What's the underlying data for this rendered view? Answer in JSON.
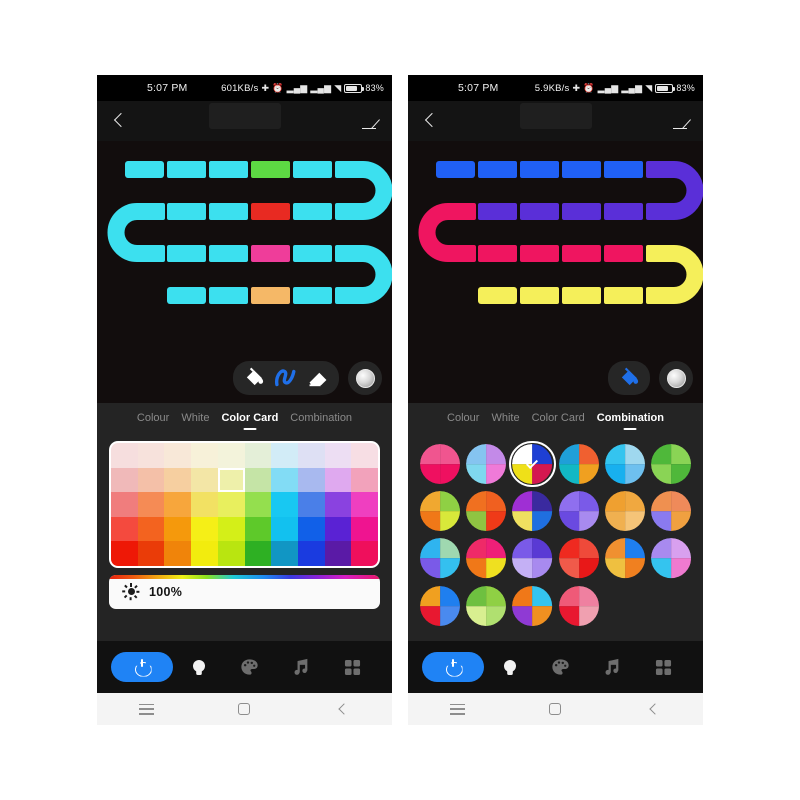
{
  "phones": [
    {
      "id": "left",
      "status": {
        "time": "5:07 PM",
        "net_speed": "601KB/s",
        "battery_pct": "83%",
        "icons": [
          "bluetooth-icon",
          "alarm-icon",
          "signal-icon",
          "signal-icon",
          "wifi-icon",
          "battery-icon"
        ]
      },
      "appbar": {
        "back": "back-icon",
        "edit": "edit-pencil-icon"
      },
      "strip": {
        "base_color": "#3ce0ef",
        "segments": [
          {
            "row": 1,
            "index": 4,
            "color": "#5dd943"
          },
          {
            "row": 2,
            "index": 4,
            "color": "#e82a22"
          },
          {
            "row": 3,
            "index": 4,
            "color": "#ef3d9a"
          },
          {
            "row": 4,
            "index": 4,
            "color": "#f5b867"
          }
        ]
      },
      "toolbar": {
        "tools": [
          {
            "name": "paint-bucket-tool",
            "active": false
          },
          {
            "name": "brush-tool",
            "active": true
          },
          {
            "name": "eraser-tool",
            "active": false
          }
        ],
        "color_knob": "color-knob-button"
      },
      "tabs": [
        {
          "label": "Colour",
          "active": false
        },
        {
          "label": "White",
          "active": false
        },
        {
          "label": "Color Card",
          "active": true
        },
        {
          "label": "Combination",
          "active": false
        }
      ],
      "panel_type": "palette",
      "palette": {
        "selected_row": 1,
        "selected_col": 4,
        "rows": [
          [
            "#f6dede",
            "#f7e2dc",
            "#f8e8d8",
            "#f7f1d9",
            "#f3f3db",
            "#e4efd8",
            "#d2ecf7",
            "#dee0f4",
            "#eddef3",
            "#f7dee4"
          ],
          [
            "#f0b9b9",
            "#f4c0a8",
            "#f6cfa0",
            "#f3e6a6",
            "#eef0aa",
            "#c5e4a6",
            "#82dcf5",
            "#a8b9ef",
            "#dfa9ef",
            "#f2a2bb"
          ],
          [
            "#f07d7d",
            "#f58b55",
            "#f7a63c",
            "#f2e163",
            "#e8ef5e",
            "#94df4e",
            "#18c8f2",
            "#4a7fe8",
            "#8a42e0",
            "#ef3fc0"
          ],
          [
            "#f44a3e",
            "#f3631f",
            "#f5990c",
            "#f5ef17",
            "#d4ef18",
            "#5ec92a",
            "#12c1ef",
            "#1160e8",
            "#5a22d4",
            "#ef1490"
          ],
          [
            "#ee1806",
            "#ea3c08",
            "#f0840a",
            "#f2ec0e",
            "#b9e510",
            "#2eb023",
            "#1196c4",
            "#1a3be0",
            "#5a1aa6",
            "#ef0f5c"
          ]
        ]
      },
      "brightness": {
        "icon": "sun-icon",
        "value": "100%"
      },
      "bottomnav": {
        "power": "power-button",
        "items": [
          "bulb-icon",
          "palette-icon",
          "music-note-icon",
          "grid-icon"
        ],
        "active": "bulb-icon",
        "accent": "#1f83f5"
      },
      "androidnav": [
        "menu-icon",
        "home-icon",
        "back-icon"
      ]
    },
    {
      "id": "right",
      "status": {
        "time": "5:07 PM",
        "net_speed": "5.9KB/s",
        "battery_pct": "83%",
        "icons": [
          "bluetooth-icon",
          "alarm-icon",
          "signal-icon",
          "signal-icon",
          "wifi-icon",
          "battery-icon"
        ]
      },
      "appbar": {
        "back": "back-icon",
        "edit": "edit-pencil-icon"
      },
      "strip": {
        "base_color": "#2050f0",
        "row_colors": [
          "#2060f5",
          "#6a2fd4",
          "#ef1560",
          "#f5ef5a"
        ]
      },
      "toolbar": {
        "tools": [
          {
            "name": "paint-bucket-tool",
            "active": true
          }
        ],
        "color_knob": "color-knob-button"
      },
      "tabs": [
        {
          "label": "Colour",
          "active": false
        },
        {
          "label": "White",
          "active": false
        },
        {
          "label": "Color Card",
          "active": false
        },
        {
          "label": "Combination",
          "active": true
        }
      ],
      "panel_type": "combination",
      "combinations": [
        {
          "selected": false,
          "slices": [
            "#f0558f",
            "#ef1060",
            "#ef1060",
            "#f0558f"
          ]
        },
        {
          "selected": false,
          "slices": [
            "#c38ae8",
            "#ef7ad8",
            "#7fd8ef",
            "#85c4f0"
          ]
        },
        {
          "selected": true,
          "slices": [
            "#1e3fd4",
            "#d41850",
            "#efe018",
            "#ffffff"
          ]
        },
        {
          "selected": false,
          "slices": [
            "#f06030",
            "#f0a020",
            "#12b8c4",
            "#1f9fd8"
          ]
        },
        {
          "selected": false,
          "slices": [
            "#9fd8ef",
            "#6ec0ef",
            "#18b0ef",
            "#34c4ef"
          ]
        },
        {
          "selected": false,
          "slices": [
            "#8ad455",
            "#4fb83a",
            "#8ad455",
            "#4fb83a"
          ]
        },
        {
          "selected": false,
          "slices": [
            "#8fd044",
            "#d8e83a",
            "#f07818",
            "#f0a830"
          ]
        },
        {
          "selected": false,
          "slices": [
            "#f06020",
            "#ef3a18",
            "#8fc442",
            "#f07020"
          ]
        },
        {
          "selected": false,
          "slices": [
            "#3a2a9f",
            "#1f6fe0",
            "#efe060",
            "#9f2fd4"
          ]
        },
        {
          "selected": false,
          "slices": [
            "#7a5ae8",
            "#a88aef",
            "#6a4ae0",
            "#8f6fef"
          ]
        },
        {
          "selected": false,
          "slices": [
            "#f0a840",
            "#f5c478",
            "#f0b050",
            "#efa030"
          ]
        },
        {
          "selected": false,
          "slices": [
            "#ef8a5a",
            "#f0a040",
            "#8a7aef",
            "#ef9050"
          ]
        },
        {
          "selected": false,
          "slices": [
            "#9fd8b0",
            "#34c0ef",
            "#7a5ae8",
            "#2fb4ef"
          ]
        },
        {
          "selected": false,
          "slices": [
            "#ef1f78",
            "#efe020",
            "#f07818",
            "#ef2a68"
          ]
        },
        {
          "selected": false,
          "slices": [
            "#5a3ad4",
            "#a88aef",
            "#c4b0f5",
            "#7a5ae8"
          ]
        },
        {
          "selected": false,
          "slices": [
            "#ef4a3a",
            "#e81818",
            "#f05a4a",
            "#ef2a20"
          ]
        },
        {
          "selected": false,
          "slices": [
            "#1f7fef",
            "#f08020",
            "#efc040",
            "#f09030"
          ]
        },
        {
          "selected": false,
          "slices": [
            "#d8a0ef",
            "#ef7ad0",
            "#34c4ef",
            "#a88aef"
          ]
        },
        {
          "selected": false,
          "slices": [
            "#1f7fef",
            "#4a8aef",
            "#e81830",
            "#f0a020"
          ]
        },
        {
          "selected": false,
          "slices": [
            "#8fd044",
            "#b0e070",
            "#d8ef90",
            "#6ec040"
          ]
        },
        {
          "selected": false,
          "slices": [
            "#34c4ef",
            "#f09020",
            "#8f3ad4",
            "#f07818"
          ]
        },
        {
          "selected": false,
          "slices": [
            "#ef80a0",
            "#f0a0b0",
            "#e81830",
            "#ef5a78"
          ]
        }
      ],
      "bottomnav": {
        "power": "power-button",
        "items": [
          "bulb-icon",
          "palette-icon",
          "music-note-icon",
          "grid-icon"
        ],
        "active": "bulb-icon",
        "accent": "#1f83f5"
      },
      "androidnav": [
        "menu-icon",
        "home-icon",
        "back-icon"
      ]
    }
  ]
}
